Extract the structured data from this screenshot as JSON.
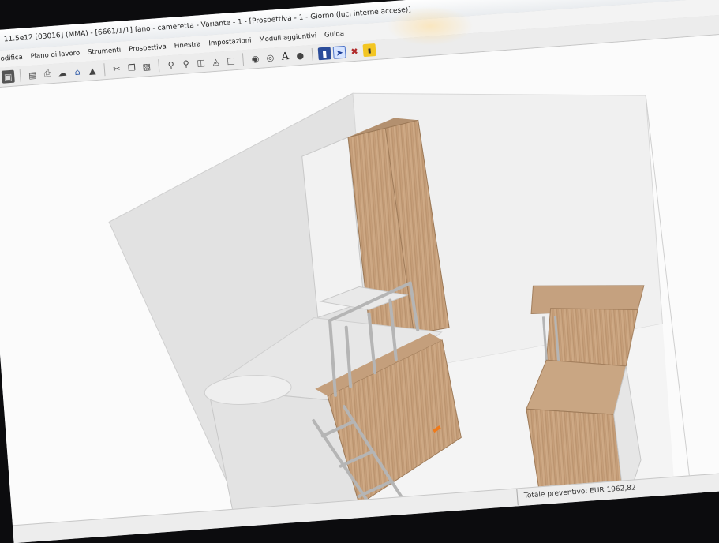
{
  "window": {
    "title": "11.5e12 [03016] (MMA) - [6661/1/1] fano - cameretta - Variante - 1 - [Prospettiva - 1 - Giorno (luci interne accese)]"
  },
  "menu": {
    "items": [
      "odifica",
      "Piano di lavoro",
      "Strumenti",
      "Prospettiva",
      "Finestra",
      "Impostazioni",
      "Moduli aggiuntivi",
      "Guida"
    ]
  },
  "toolbar": {
    "icons": [
      "save-icon",
      "folder-icon",
      "print-icon",
      "cloud-icon",
      "zoom-in-icon",
      "zoom-out-icon",
      "view-front-icon",
      "view-side-icon",
      "frame-icon",
      "text-icon",
      "light-icon",
      "render-icon",
      "select-arrow-icon",
      "tools-icon",
      "plugin-icon"
    ],
    "text_tool_label": "A"
  },
  "status": {
    "quote": "Totale preventivo: EUR 1962,82"
  },
  "colors": {
    "wood": "#c8a07c",
    "wood_dark": "#a88360",
    "white_furniture": "#ebebeb",
    "ladder": "#b5b5b5",
    "accent_orange": "#f07a1a"
  }
}
